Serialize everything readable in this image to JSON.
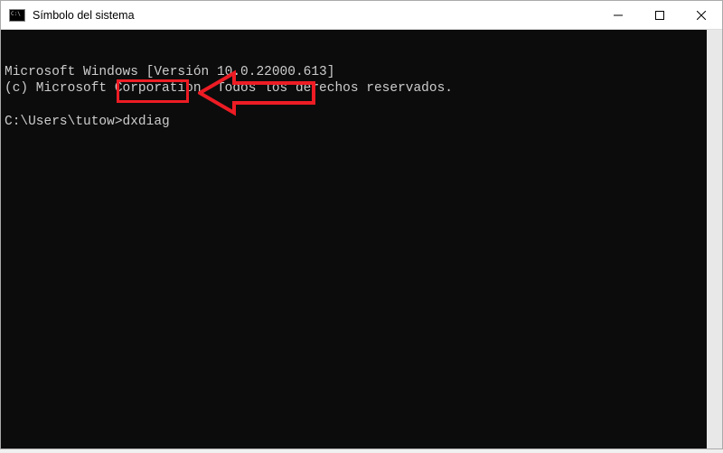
{
  "titlebar": {
    "title": "Símbolo del sistema"
  },
  "terminal": {
    "line1": "Microsoft Windows [Versión 10.0.22000.613]",
    "line2": "(c) Microsoft Corporation. Todos los derechos reservados.",
    "prompt": "C:\\Users\\tutow>",
    "command": "dxdiag"
  },
  "annotation": {
    "color": "#ed1c24"
  }
}
